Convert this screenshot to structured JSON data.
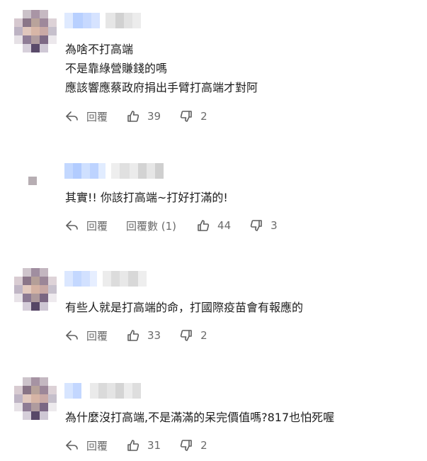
{
  "comments": [
    {
      "lines": [
        "為啥不打高端",
        "不是靠綠營賺錢的嗎",
        "應該響應蔡政府捐出手臂打高端才對阿"
      ],
      "reply_label": "回覆",
      "likes": "39",
      "dislikes": "2"
    },
    {
      "lines": [
        "其實!! 你該打高端~打好打滿的!"
      ],
      "reply_label": "回覆",
      "replies_label": "回覆數 (1)",
      "likes": "44",
      "dislikes": "3"
    },
    {
      "lines": [
        "有些人就是打高端的命，打國際疫苗會有報應的"
      ],
      "reply_label": "回覆",
      "likes": "33",
      "dislikes": "2"
    },
    {
      "lines": [
        "為什麼沒打高端,不是滿滿的呆完價值嗎?817也怕死喔"
      ],
      "reply_label": "回覆",
      "likes": "31",
      "dislikes": "2"
    }
  ],
  "icons": {
    "reply": "reply-arrow-icon",
    "like": "thumbs-up-icon",
    "dislike": "thumbs-down-icon"
  },
  "colors": {
    "text": "#1d1d1d",
    "muted": "#6b6b6b",
    "name_blur_light": "#c9dcff",
    "name_blur_gray": "#d9d9d9"
  }
}
